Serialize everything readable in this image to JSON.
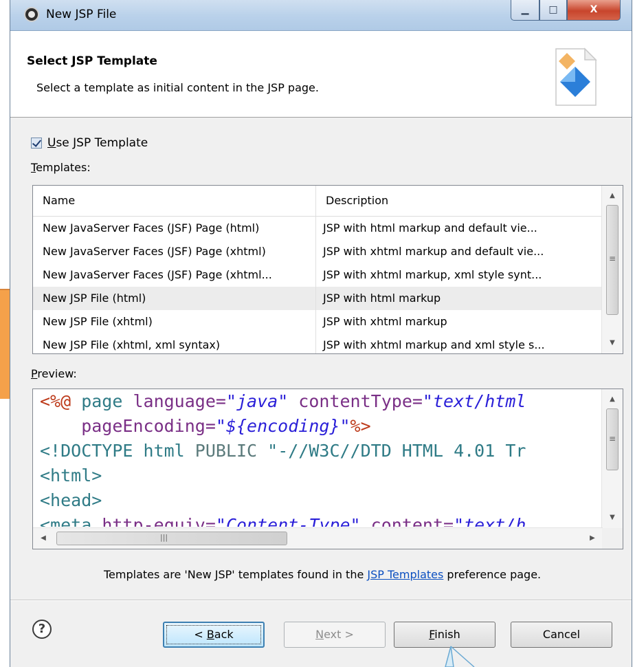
{
  "window": {
    "title": "New JSP File"
  },
  "header": {
    "title": "Select JSP Template",
    "description": "Select a template as initial content in the JSP page."
  },
  "use_template": {
    "label_u": "U",
    "label_rest": "se JSP Template",
    "checked": true
  },
  "templates_label": {
    "u": "T",
    "rest": "emplates:"
  },
  "table": {
    "columns": [
      "Name",
      "Description"
    ],
    "rows": [
      {
        "name": "New JavaServer Faces (JSF) Page (html)",
        "description": "JSP with html markup and default vie..."
      },
      {
        "name": "New JavaServer Faces (JSF) Page (xhtml)",
        "description": "JSP with xhtml markup and default vie..."
      },
      {
        "name": "New JavaServer Faces (JSF) Page (xhtml...",
        "description": "JSP with xhtml markup, xml style synt..."
      },
      {
        "name": "New JSP File (html)",
        "description": "JSP with html markup"
      },
      {
        "name": "New JSP File (xhtml)",
        "description": "JSP with xhtml markup"
      },
      {
        "name": "New JSP File (xhtml, xml syntax)",
        "description": "JSP with xhtml markup and xml style s..."
      }
    ],
    "selected_row": "New JSP File (html)"
  },
  "preview_label": {
    "u": "P",
    "rest": "review:"
  },
  "preview_code": {
    "l1": {
      "open": "<%@",
      "page": " page ",
      "lang_attr": "language=",
      "lang_val": "\"java\"",
      "ct_attr": " contentType=",
      "ct_val": "\"text/html"
    },
    "l2": {
      "pe_attr": "    pageEncoding=",
      "pe_val": "\"${encoding}\"",
      "close": "%>"
    },
    "l3": {
      "doctype": "<!DOCTYPE html ",
      "public": "PUBLIC ",
      "dtd": "\"-//W3C//DTD HTML 4.01 Tr"
    },
    "l4": "<html>",
    "l5": "<head>",
    "l6": {
      "meta": "<meta ",
      "he_attr": "http-equiv=",
      "he_val": "\"Content-Type\"",
      "c_attr": " content=",
      "c_val": "\"text/h"
    }
  },
  "footer_note": {
    "before": "Templates are 'New JSP' templates found in the ",
    "link": "JSP Templates",
    "after": " preference page."
  },
  "buttons": {
    "back_prefix": "< ",
    "back_u": "B",
    "back_rest": "ack",
    "next_u": "N",
    "next_rest": "ext >",
    "finish_u": "F",
    "finish_rest": "inish",
    "cancel": "Cancel"
  },
  "icons": {
    "help": "?",
    "scroll_up": "▲",
    "scroll_down": "▼",
    "scroll_left": "◀",
    "scroll_right": "▶",
    "grip": "≡",
    "hgrip": "|||",
    "minimize": "▁",
    "maximize": "□",
    "close": "X"
  },
  "colors": {
    "accent_orange": "#f5a14a",
    "link": "#0b4fc0",
    "selection": "#ececec"
  }
}
